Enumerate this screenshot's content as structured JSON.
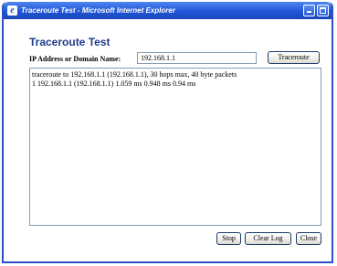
{
  "window": {
    "title": "Traceroute Test - Microsoft Internet Explorer",
    "icon": "internet-explorer-icon"
  },
  "page": {
    "title": "Traceroute Test",
    "ip_label": "IP Address or Domain Name:",
    "ip_value": "192.168.1.1",
    "traceroute_button": "Traceroute",
    "log_lines": [
      "traceroute to 192.168.1.1 (192.168.1.1), 30 hops max, 40 byte packets",
      "1 192.168.1.1 (192.168.1.1) 1.059 ms 0.948 ms 0.94 ms"
    ],
    "stop_button": "Stop",
    "clearlog_button": "Clear Log",
    "close_button": "Close"
  },
  "colors": {
    "titlebar": "#1f56d8",
    "heading": "#1f3c8a"
  }
}
